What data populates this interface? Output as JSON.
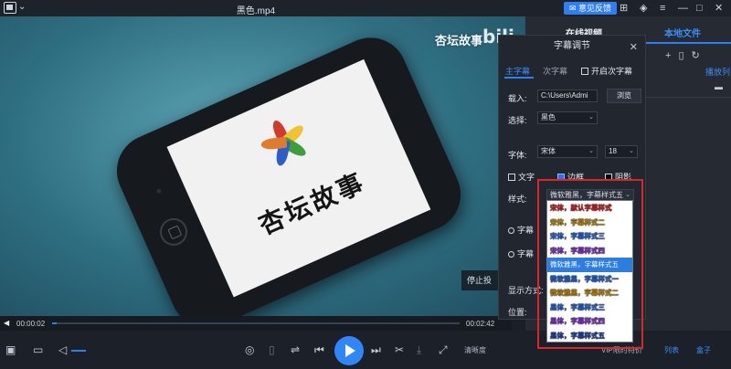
{
  "titlebar": {
    "title": "黑色.mp4",
    "feedback_label": "意见反馈"
  },
  "video": {
    "brand_text": "杏坛故事",
    "watermark": "杏坛故事",
    "watermark_logo": "bili",
    "stop_label": "停止投"
  },
  "playback": {
    "current_time": "00:00:02",
    "total_time": "00:02:42",
    "progress": 0.012
  },
  "controls": {
    "quality_label": "清晰度",
    "vip_label": "VIP限时特价",
    "list_label": "列表",
    "box_label": "盒子",
    "volume_level": 0.45
  },
  "right_panel": {
    "tab_online": "在线视频",
    "tab_local": "本地文件",
    "playlist_label": "播放列"
  },
  "subtitle_dialog": {
    "title": "字幕调节",
    "tab_main": "主字幕",
    "tab_secondary": "次字幕",
    "enable_secondary": "开启次字幕",
    "load_label": "载入:",
    "load_path": "C:\\Users\\Admi",
    "browse_label": "浏览",
    "select_label": "选择:",
    "select_value": "黑色",
    "font_label": "字体:",
    "font_value": "宋体",
    "font_size": "18",
    "text_label": "文字",
    "border_label": "边框",
    "shadow_label": "阴影",
    "style_label": "样式:",
    "style_value": "微软雅黑，字幕样式五",
    "radio1_label": "字幕",
    "radio2_label": "字幕",
    "display_mode_label": "显示方式:",
    "position_label": "位置:"
  },
  "style_options": [
    {
      "label": "宋体，默认字幕样式",
      "color": "#c81e1e"
    },
    {
      "label": "宋体，字幕样式二",
      "color": "#b5850a"
    },
    {
      "label": "宋体，字幕样式三",
      "color": "#1e5fd0"
    },
    {
      "label": "宋体，字幕样式四",
      "color": "#7a2ec4"
    },
    {
      "label": "微软雅黑，字幕样式五",
      "color": "#ffffff",
      "selected": true
    },
    {
      "label": "微软雅黑，字幕样式一",
      "color": "#1e5fd0"
    },
    {
      "label": "微软雅黑，字幕样式二",
      "color": "#b5850a"
    },
    {
      "label": "黑体，字幕样式三",
      "color": "#1e5fd0"
    },
    {
      "label": "黑体，字幕样式四",
      "color": "#7a2ec4"
    },
    {
      "label": "黑体，字幕样式五",
      "color": "#1e3fa0"
    }
  ],
  "colors": {
    "accent": "#2f7ff0",
    "highlight_frame": "#d8262a"
  }
}
